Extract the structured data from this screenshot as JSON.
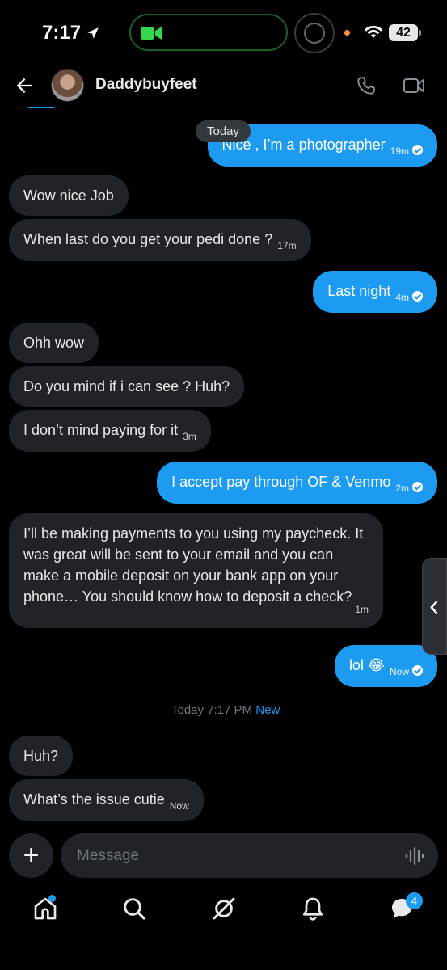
{
  "status_bar": {
    "time": "7:17",
    "battery": "42"
  },
  "header": {
    "contact_name": "Daddybuyfeet"
  },
  "chat": {
    "today_pill": "Today",
    "messages": [
      {
        "text": "Nice , I’m a photographer",
        "time": "19m"
      },
      {
        "text": "Wow nice Job"
      },
      {
        "text": "When last do you get your pedi done ?",
        "time": "17m"
      },
      {
        "text": "Last night",
        "time": "4m"
      },
      {
        "text": "Ohh wow"
      },
      {
        "text": "Do you mind if i can see ? Huh?"
      },
      {
        "text": "I don’t mind paying for it",
        "time": "3m"
      },
      {
        "text": "I accept pay through OF & Venmo",
        "time": "2m"
      },
      {
        "text": "I’ll be making payments to you using my paycheck. It was great will be sent to your email and you can make a mobile deposit on your bank app on your phone… You should know how to deposit a check?",
        "time": "1m"
      },
      {
        "text": "lol 😂",
        "time": "Now"
      },
      {
        "text": "Huh?"
      },
      {
        "text": "What’s the issue cutie",
        "time": "Now"
      }
    ],
    "divider": {
      "label": "Today 7:17 PM",
      "new_label": "New"
    }
  },
  "composer": {
    "placeholder": "Message",
    "plus_label": "+"
  },
  "nav": {
    "messages_badge": "4"
  },
  "colors": {
    "accent": "#1d9bf0",
    "incoming_bubble": "#202327",
    "background": "#000000"
  },
  "icons": [
    "back-arrow-icon",
    "phone-icon",
    "video-icon",
    "voice-icon",
    "home-icon",
    "search-icon",
    "grok-icon",
    "bell-icon",
    "messages-icon"
  ]
}
